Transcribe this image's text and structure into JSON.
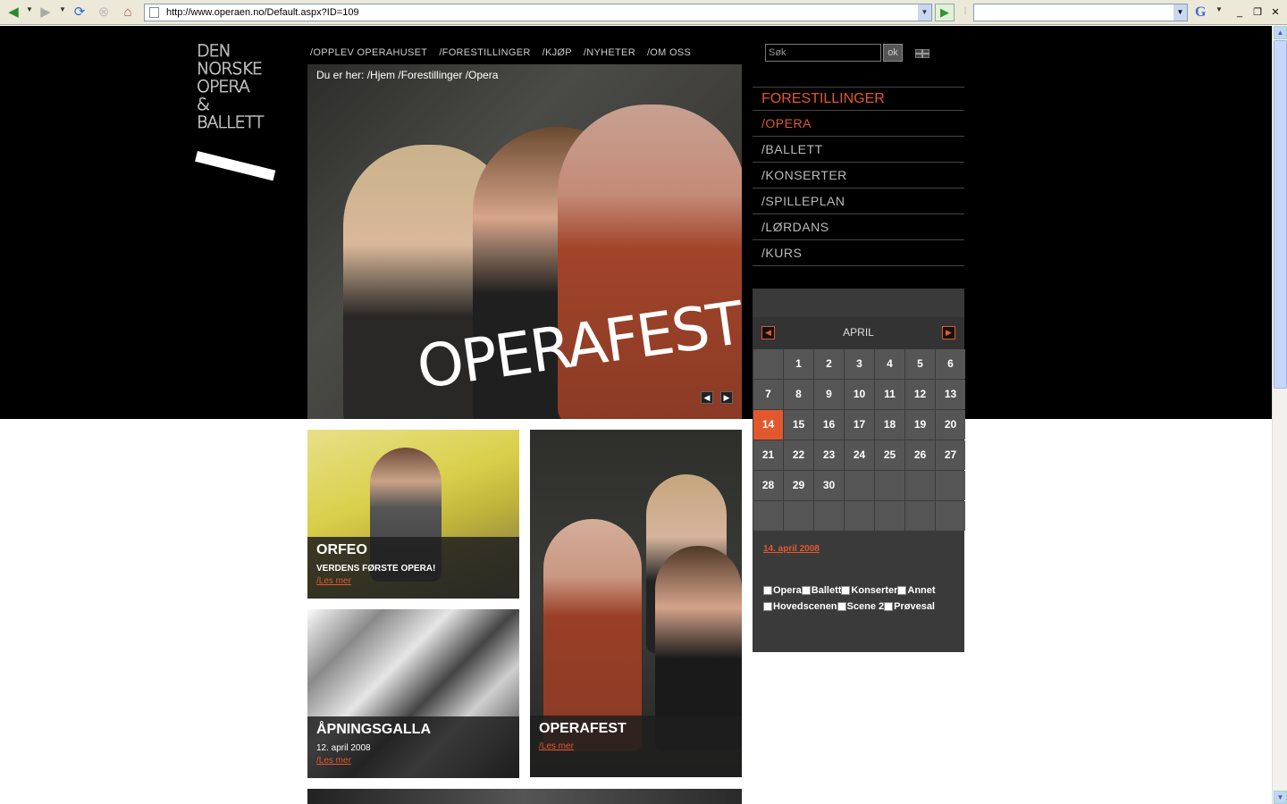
{
  "browser": {
    "url": "http://www.operaen.no/Default.aspx?ID=109",
    "search_engine_letter": "G"
  },
  "logo": {
    "lines": [
      "DEN",
      "NORSKE",
      "OPERA",
      "&",
      "BALLETT"
    ]
  },
  "topnav": {
    "items": [
      "/OPPLEV OPERAHUSET",
      "/FORESTILLINGER",
      "/KJØP",
      "/NYHETER",
      "/OM OSS"
    ]
  },
  "hero": {
    "breadcrumb": "Du er her: /Hjem /Forestillinger /Opera",
    "word": "OPERAFEST"
  },
  "search": {
    "placeholder": "Søk",
    "ok_label": "ok"
  },
  "sidenav": {
    "title": "FORESTILLINGER",
    "items": [
      "/OPERA",
      "/BALLETT",
      "/KONSERTER",
      "/SPILLEPLAN",
      "/LØRDANS",
      "/KURS"
    ],
    "active_index": 0
  },
  "calendar": {
    "month": "APRIL",
    "days": [
      "",
      "1",
      "2",
      "3",
      "4",
      "5",
      "6",
      "7",
      "8",
      "9",
      "10",
      "11",
      "12",
      "13",
      "14",
      "15",
      "16",
      "17",
      "18",
      "19",
      "20",
      "21",
      "22",
      "23",
      "24",
      "25",
      "26",
      "27",
      "28",
      "29",
      "30",
      "",
      "",
      "",
      "",
      "",
      "",
      "",
      "",
      "",
      "",
      ""
    ],
    "today": "14",
    "selected_date": "14. april 2008",
    "filters": [
      "Opera",
      "Ballett",
      "Konserter",
      "Annet",
      "Hovedscenen",
      "Scene 2",
      "Prøvesal"
    ]
  },
  "tiles": {
    "orfeo": {
      "title": "ORFEO",
      "subtitle": "VERDENS FØRSTE OPERA!",
      "more": "/Les mer"
    },
    "galla": {
      "title": "ÅPNINGSGALLA",
      "subtitle": "12. april 2008",
      "more": "/Les mer"
    },
    "operafest": {
      "title": "OPERAFEST",
      "more": "/Les mer"
    }
  },
  "colors": {
    "accent": "#e2582e",
    "background": "#000000"
  }
}
